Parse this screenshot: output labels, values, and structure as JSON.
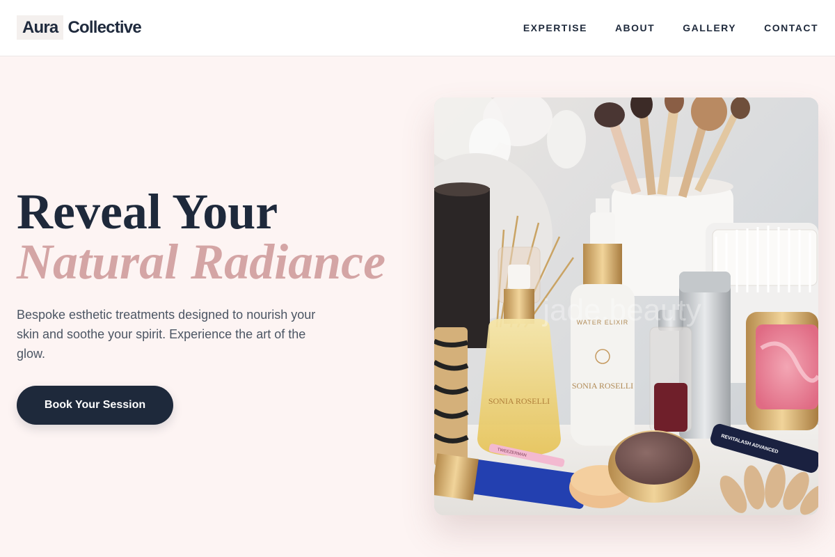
{
  "brand": {
    "word1": "Aura",
    "word2": "Collective"
  },
  "nav": {
    "items": [
      "EXPERTISE",
      "ABOUT",
      "GALLERY",
      "CONTACT"
    ]
  },
  "hero": {
    "title_line1": "Reveal Your",
    "title_line2": "Natural Radiance",
    "subtitle": "Bespoke esthetic treatments designed to nourish your skin and soothe your spirit. Experience the art of the glow.",
    "cta_label": "Book Your Session"
  },
  "image": {
    "watermark": "jade.beauty",
    "bottle_left_label": "SONIA ROSELLI",
    "bottle_center_top": "WATER ELIXIR",
    "bottle_center_label": "SONIA ROSELLI",
    "mascara_label": "REVITALASH ADVANCED",
    "tweezer_label": "TWEEZERMAN"
  },
  "colors": {
    "background": "#fdf4f3",
    "primary": "#1e293b",
    "accent": "#d4a5a5",
    "body_text": "#4b5563"
  }
}
